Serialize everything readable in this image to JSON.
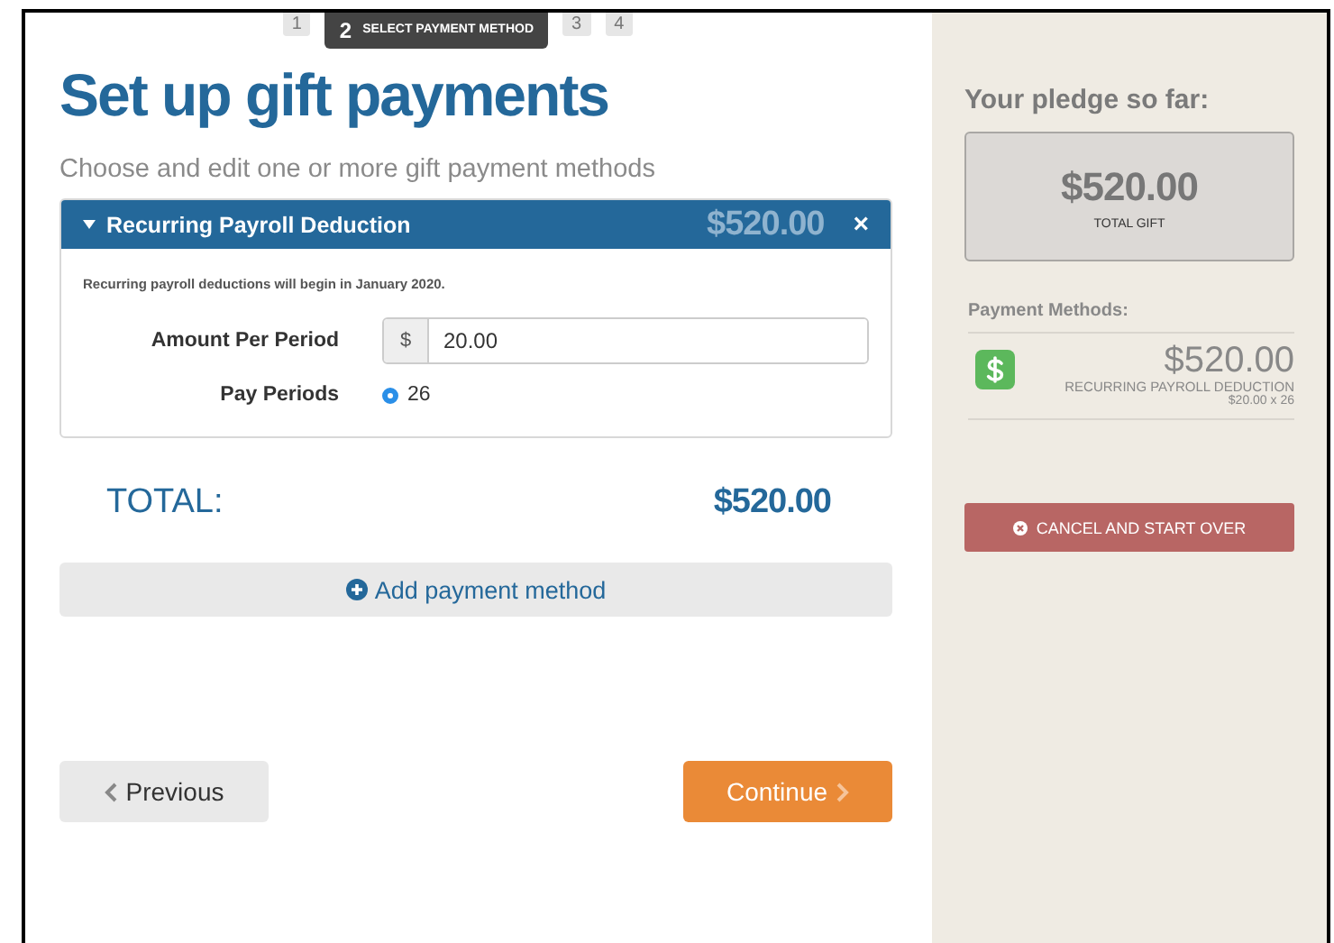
{
  "steps": [
    {
      "number": "1",
      "selected": false
    },
    {
      "number": "2",
      "label": "SELECT PAYMENT METHOD",
      "selected": true
    },
    {
      "number": "3",
      "selected": false
    },
    {
      "number": "4",
      "selected": false
    }
  ],
  "heading": "Set up gift payments",
  "subheading": "Choose and edit one or more gift payment methods",
  "methods": [
    {
      "title": "Recurring Payroll Deduction",
      "amount": "$520.00",
      "close": "×",
      "expanded": true,
      "note": "Recurring payroll deductions will begin in January 2020.",
      "fields": [
        {
          "kind": "money",
          "label": "Amount Per Period",
          "prefix": "$",
          "value": "20.00"
        },
        {
          "kind": "radio",
          "label": "Pay Periods",
          "options": [
            {
              "label": "26",
              "selected": true
            }
          ]
        }
      ]
    }
  ],
  "total": {
    "label": "TOTAL:",
    "amount": "$520.00"
  },
  "add_button": "Add payment method",
  "nav": {
    "previous": "Previous",
    "continue": "Continue"
  },
  "sidebar": {
    "title": "Your pledge so far:",
    "total": "$520.00",
    "total_label": "TOTAL GIFT",
    "methods_title": "Payment Methods:",
    "methods": [
      {
        "amount": "$520.00",
        "name": "RECURRING PAYROLL DEDUCTION",
        "detail": "$20.00 x 26"
      }
    ],
    "cancel": "CANCEL AND START OVER"
  }
}
